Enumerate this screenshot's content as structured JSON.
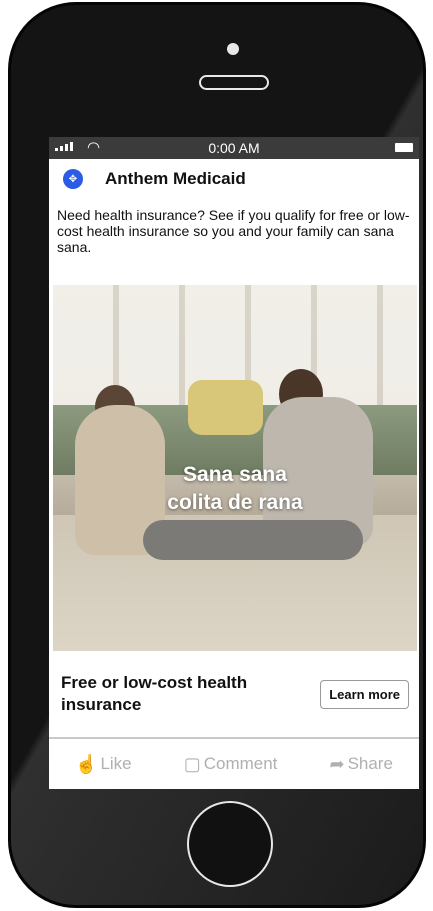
{
  "status_bar": {
    "time": "0:00 AM"
  },
  "ad": {
    "brand_name": "Anthem Medicaid",
    "logo_icon": "anthem-shield-icon",
    "body_text": "Need health insurance? See if you qualify for free or low-cost health insurance so you and your family can sana sana.",
    "image_overlay_line1": "Sana sana",
    "image_overlay_line2": "colita de rana",
    "cta_headline": "Free or low-cost health insurance",
    "cta_button": "Learn more"
  },
  "actions": {
    "like": "Like",
    "comment": "Comment",
    "share": "Share"
  },
  "colors": {
    "brand_blue": "#2a5ce6",
    "status_bar": "#3b3b3b",
    "action_text": "#b0b0b0"
  }
}
